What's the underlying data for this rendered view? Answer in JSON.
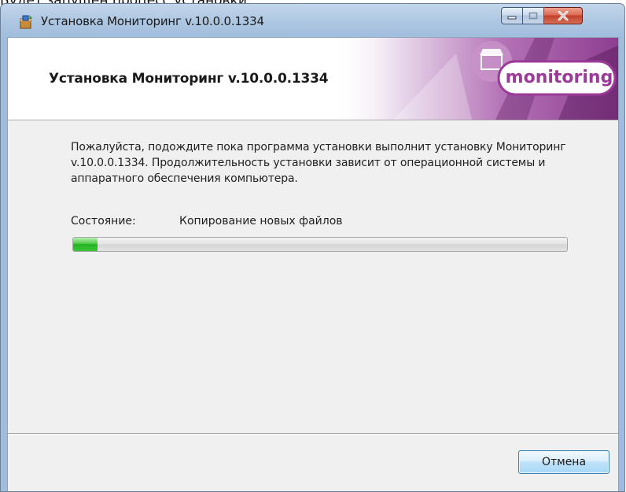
{
  "document": {
    "overlay_text": "Будет запущен процесс установки."
  },
  "window": {
    "title": "Установка Мониторинг v.10.0.0.1334",
    "icons": {
      "app": "installer-icon",
      "minimize": "minimize-icon",
      "maximize": "maximize-icon",
      "close": "close-icon"
    }
  },
  "header": {
    "title": "Установка Мониторинг v.10.0.0.1334",
    "logo_text": "monitoring",
    "logo_color": "#9b3a99"
  },
  "body": {
    "description": "Пожалуйста, подождите пока программа установки выполнит установку Мониторинг v.10.0.0.1334. Продолжительность установки зависит от операционной системы и аппаратного обеспечения компьютера.",
    "status_label": "Состояние:",
    "status_value": "Копирование новых файлов",
    "progress_fraction": 0.05
  },
  "footer": {
    "cancel_label": "Отмена"
  }
}
